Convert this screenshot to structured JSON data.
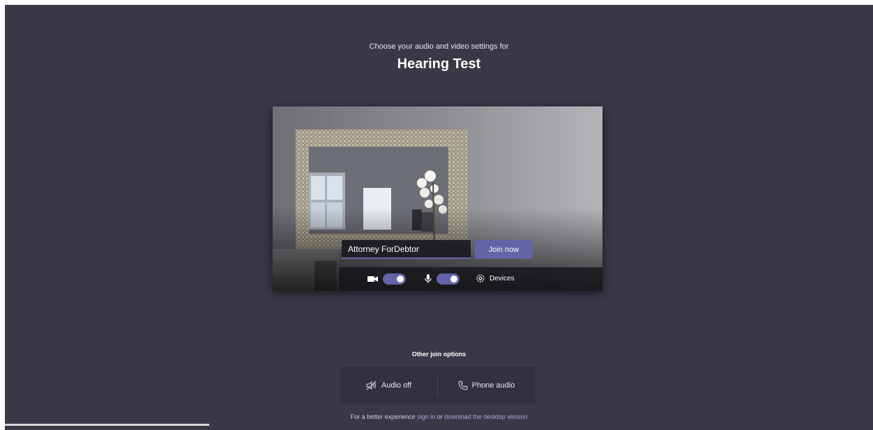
{
  "header": {
    "subtitle": "Choose your audio and video settings for",
    "meeting_title": "Hearing Test"
  },
  "preview": {
    "name_value": "Attorney ForDebtor",
    "join_label": "Join now",
    "camera_on": true,
    "mic_on": true,
    "devices_label": "Devices"
  },
  "other_options": {
    "title": "Other join options",
    "audio_off_label": "Audio off",
    "phone_audio_label": "Phone audio"
  },
  "footer": {
    "prefix": "For a better experience ",
    "sign_in": "sign in",
    "middle": " or ",
    "download": "download the desktop version"
  },
  "colors": {
    "background": "#3a3847",
    "accent": "#6264a7",
    "link": "#a4a6e0"
  }
}
